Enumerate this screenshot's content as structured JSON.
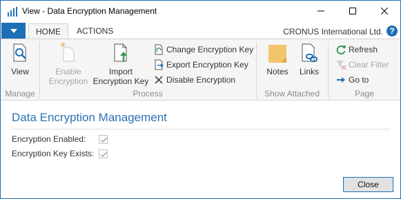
{
  "window": {
    "title": "View - Data Encryption Management",
    "accent_color": "#1e6fb5"
  },
  "ribbon_tabs": {
    "home": "HOME",
    "actions": "ACTIONS"
  },
  "company": "CRONUS International Ltd.",
  "help_icon_glyph": "?",
  "ribbon": {
    "manage": {
      "label": "Manage",
      "view": "View"
    },
    "process": {
      "label": "Process",
      "enable_line1": "Enable",
      "enable_line2": "Encryption",
      "import_line1": "Import",
      "import_line2": "Encryption Key",
      "change_key": "Change Encryption Key",
      "export_key": "Export Encryption Key",
      "disable": "Disable Encryption"
    },
    "show_attached": {
      "label": "Show Attached",
      "notes": "Notes",
      "links": "Links"
    },
    "page": {
      "label": "Page",
      "refresh": "Refresh",
      "clear_filter": "Clear Filter",
      "go_to": "Go to"
    }
  },
  "content": {
    "title": "Data Encryption Management",
    "fields": [
      {
        "label": "Encryption Enabled:",
        "checked": true
      },
      {
        "label": "Encryption Key Exists:",
        "checked": true
      }
    ],
    "close_button": "Close"
  }
}
